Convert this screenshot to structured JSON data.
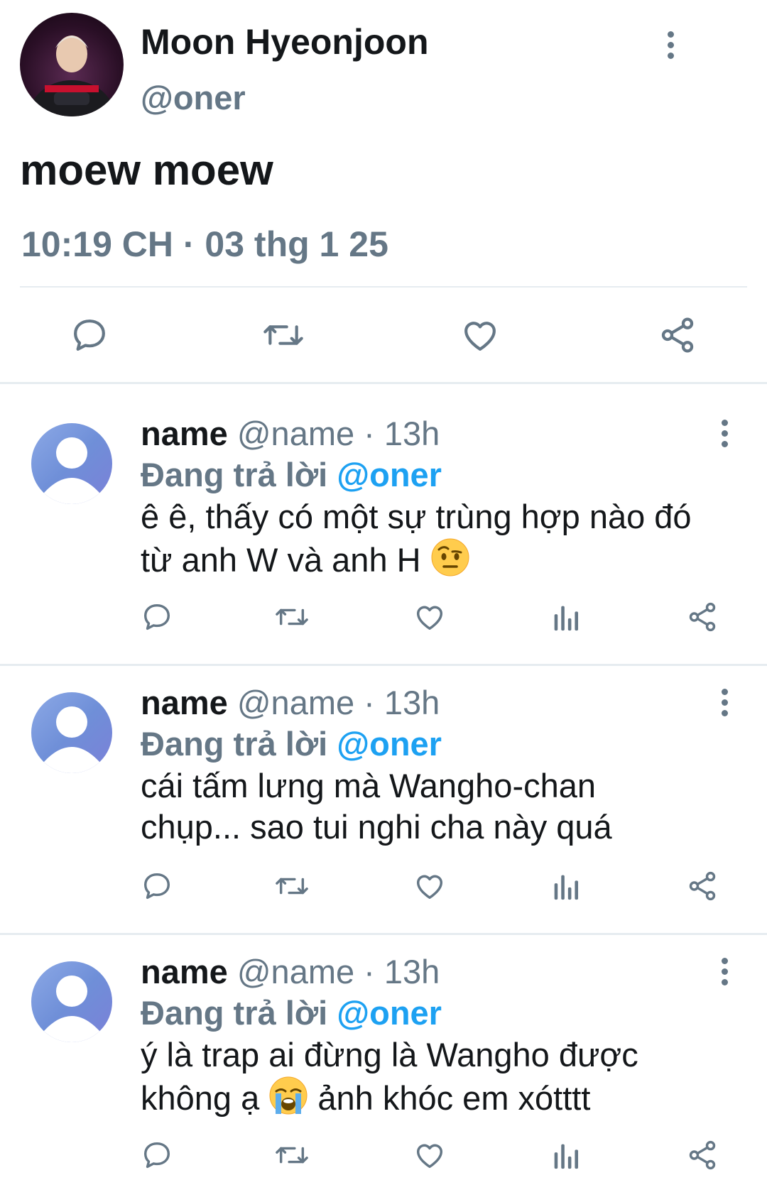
{
  "main_tweet": {
    "author_name": "Moon Hyeonjoon",
    "author_handle": "@oner",
    "text": "moew moew",
    "timestamp": "10:19 CH · 03 thg 1 25"
  },
  "replies": [
    {
      "name": "name",
      "meta": " @name · 13h",
      "replying_prefix": "Đang trả lời ",
      "replying_to": "@oner",
      "text_line1": "ê ê, thấy có một sự trùng hợp nào đó",
      "text_line2": "từ anh W và anh H ",
      "emoji": "face-with-raised-eyebrow"
    },
    {
      "name": "name",
      "meta": " @name · 13h",
      "replying_prefix": "Đang trả lời ",
      "replying_to": "@oner",
      "text_line1": "cái tấm lưng mà Wangho-chan",
      "text_line2": "chụp... sao tui nghi cha này quá"
    },
    {
      "name": "name",
      "meta": " @name · 13h",
      "replying_prefix": "Đang trả lời ",
      "replying_to": "@oner",
      "text_line1": "ý là trap ai đừng là Wangho được",
      "text_line2_a": "không ạ ",
      "text_line2_b": " ảnh khóc em xótttt",
      "emoji": "loudly-crying-face"
    }
  ],
  "colors": {
    "text": "#14171a",
    "secondary": "#657786",
    "link": "#1da1f2",
    "divider": "#e6ecf0"
  },
  "icons": [
    "reply-icon",
    "retweet-icon",
    "like-icon",
    "share-icon",
    "analytics-icon",
    "more-icon"
  ]
}
